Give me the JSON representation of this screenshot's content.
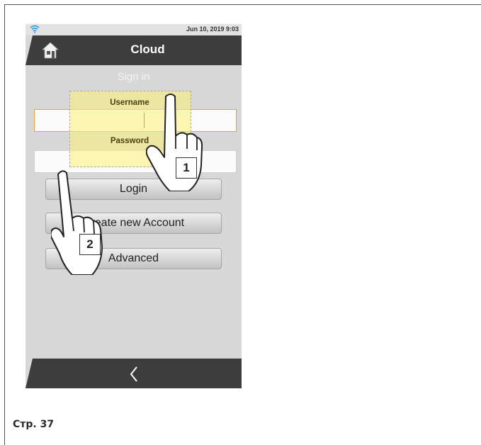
{
  "status_bar": {
    "datetime": "Jun 10, 2019 9:03",
    "wifi_icon": "wifi-icon"
  },
  "header": {
    "title": "Cloud",
    "home_icon": "home-icon"
  },
  "signin_heading": "Sign in",
  "form": {
    "username_label": "Username",
    "username_value": "",
    "password_label": "Password",
    "password_value": ""
  },
  "buttons": {
    "login": "Login",
    "create_account": "Create new Account",
    "advanced": "Advanced"
  },
  "footer": {
    "back_icon": "chevron-left-icon"
  },
  "callouts": {
    "step1": "1",
    "step2": "2"
  },
  "caption": "Стр. 37",
  "colors": {
    "header": "#3d3d3d",
    "screen_bg": "#d7d7d7",
    "highlight": "#fff278",
    "focus_border": "#f0a040"
  }
}
